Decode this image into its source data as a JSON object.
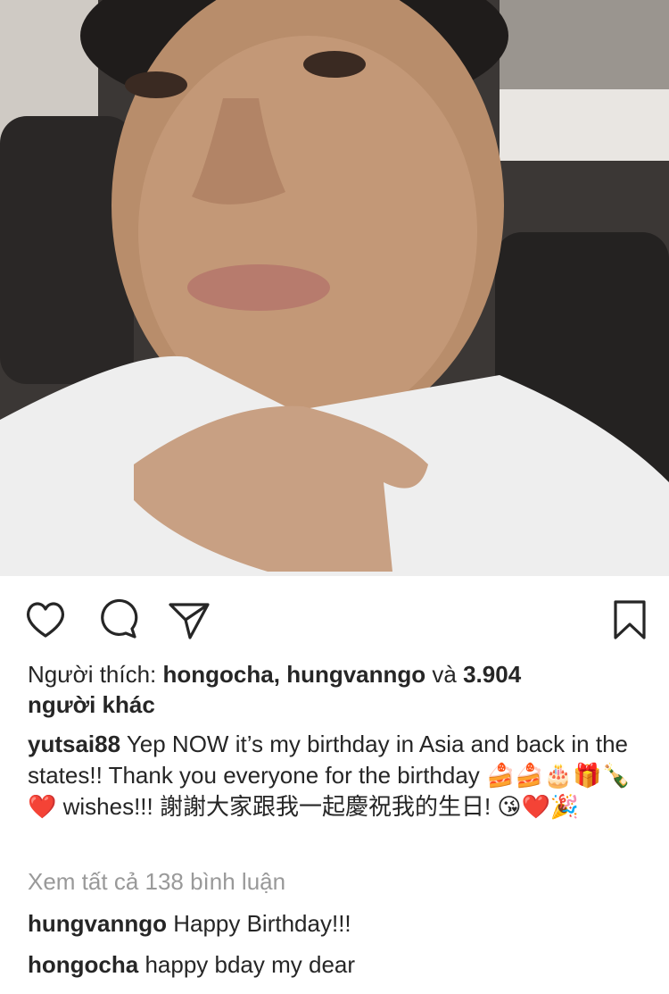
{
  "post": {
    "photo_alt": "selfie photo",
    "actions": {
      "like_icon": "heart-outline-icon",
      "comment_icon": "speech-bubble-icon",
      "share_icon": "paper-plane-icon",
      "save_icon": "bookmark-icon"
    },
    "likes": {
      "prefix": "Người thích: ",
      "user1": "hongocha",
      "sep": ", ",
      "user2": "hungvanngo",
      "and": " và ",
      "count": "3.904",
      "suffix": "người khác"
    },
    "caption": {
      "username": "yutsai88",
      "text1": " Yep NOW it’s my birthday in Asia and back in the states!! Thank you everyone for the birthday ",
      "emojis1": "🍰🍰🎂🎁🍾❤️",
      "text2": " wishes!!! 謝謝大家跟我一起慶祝我的生日! ",
      "emojis2": "😘❤️🎉"
    },
    "view_all_comments": "Xem tất cả 138 bình luận",
    "comments": [
      {
        "username": "hungvanngo",
        "text": " Happy Birthday!!!"
      },
      {
        "username": "hongocha",
        "text": " happy bday my dear"
      }
    ]
  }
}
